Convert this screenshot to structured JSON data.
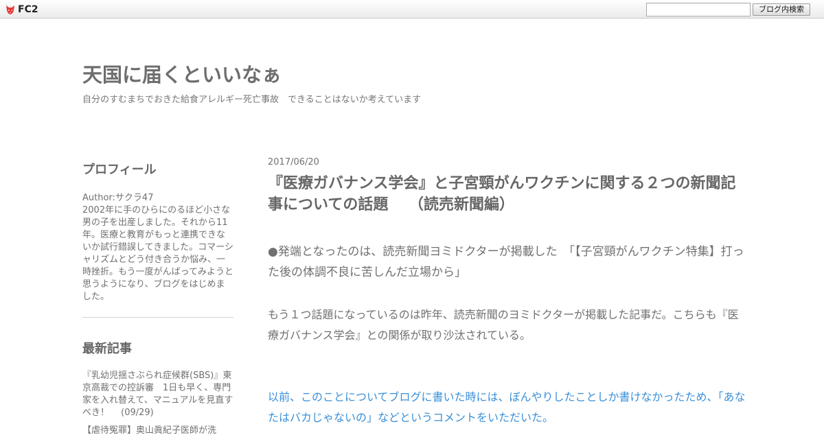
{
  "topbar": {
    "logo_text": "FC2",
    "search_placeholder": "",
    "search_button_label": "ブログ内検索",
    "logo_color": "#e83a3a"
  },
  "blog": {
    "title": "天国に届くといいなぁ",
    "description": "自分のすむまちでおきた給食アレルギー死亡事故　できることはないか考えています"
  },
  "sidebar": {
    "profile_heading": "プロフィール",
    "profile_author": "Author:サクラ47",
    "profile_body": "2002年に手のひらにのるほど小さな男の子を出産しました。それから11年。医療と教育がもっと連携できないか試行錯誤してきました。コマーシャリズムとどう付き合うか悩み、一時挫折。もう一度がんばってみようと思うようになり、ブログをはじめました。",
    "recent_heading": "最新記事",
    "recent_items": [
      "『乳幼児揺さぶられ症候群(SBS)』東京高裁での控訴審　1日も早く、専門家を入れ替えて、マニュアルを見直すべき！　 (09/29)",
      "【虐待冤罪】奥山眞紀子医師が洗"
    ]
  },
  "post": {
    "date": "2017/06/20",
    "title": "『医療ガバナンス学会』と子宮頸がんワクチンに関する２つの新聞記事についての話題　 （読売新聞編）",
    "paragraphs": [
      "●発端となったのは、読売新聞ヨミドクターが掲載した　「【子宮頸がんワクチン特集】打った後の体調不良に苦しんだ立場から」",
      "もう１つ話題になっているのは昨年、読売新聞のヨミドクターが掲載した記事だ。こちらも『医療ガバナンス学会』との関係が取り沙汰されている。",
      "以前、このことについてブログに書いた時には、ぼんやりしたことしか書けなかったため、「あなたはバカじゃないの」などというコメントをいただいた。"
    ],
    "link_color": "#3a8fd8"
  }
}
